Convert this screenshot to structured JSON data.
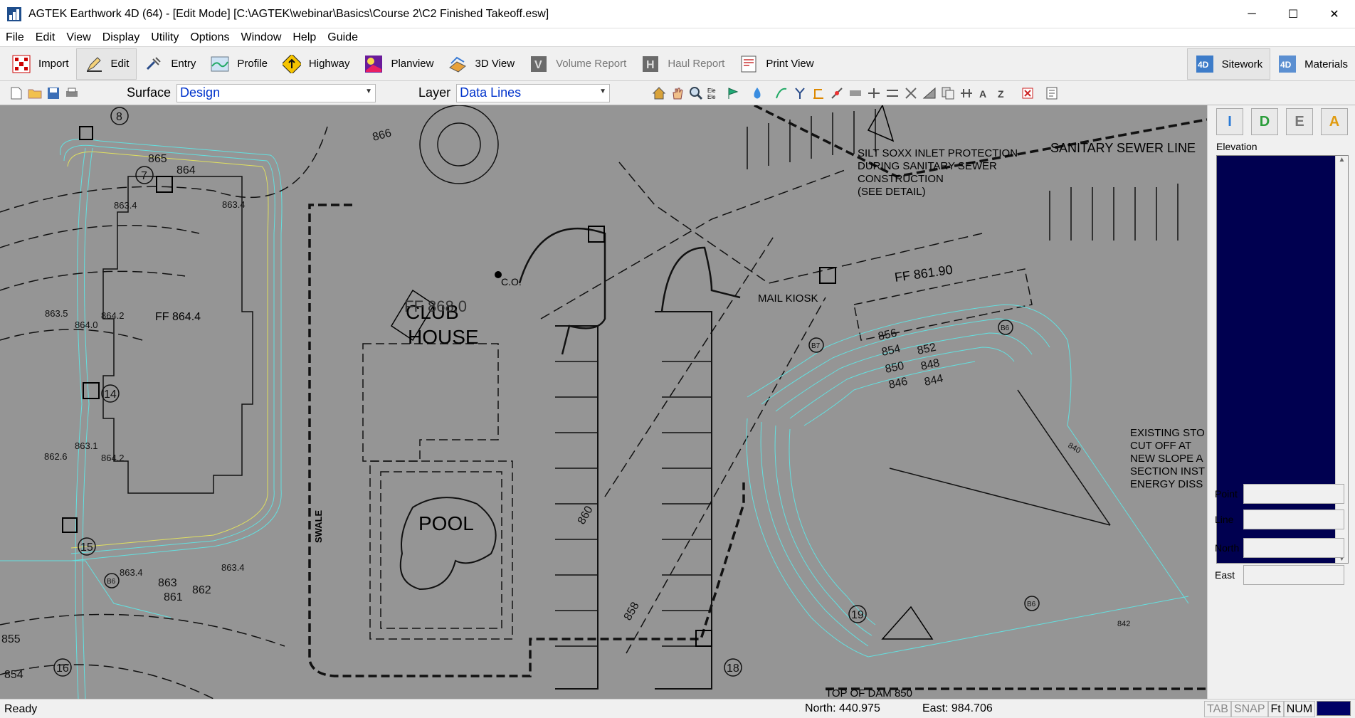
{
  "window": {
    "title": "AGTEK Earthwork 4D (64) - [Edit Mode]  [C:\\AGTEK\\webinar\\Basics\\Course 2\\C2 Finished Takeoff.esw]",
    "controls": [
      "─",
      "☐",
      "✕"
    ]
  },
  "menu": {
    "items": [
      "File",
      "Edit",
      "View",
      "Display",
      "Utility",
      "Options",
      "Window",
      "Help",
      "Guide"
    ]
  },
  "modes": {
    "import": "Import",
    "edit": "Edit",
    "entry": "Entry",
    "profile": "Profile",
    "highway": "Highway",
    "planview": "Planview",
    "view3d": "3D View",
    "volume_report": "Volume Report",
    "haul_report": "Haul Report",
    "print_view": "Print View",
    "sitework": "Sitework",
    "materials": "Materials"
  },
  "toolbar": {
    "surface_label": "Surface",
    "surface_value": "Design",
    "layer_label": "Layer",
    "layer_value": "Data Lines"
  },
  "sidepanel": {
    "buttons": [
      "I",
      "D",
      "E",
      "A"
    ],
    "elevation_label": "Elevation",
    "point_label": "Point",
    "line_label": "Line",
    "north_label": "North",
    "east_label": "East"
  },
  "drawing": {
    "labels": {
      "club": "CLUB",
      "house": "HOUSE",
      "pool": "POOL",
      "ff_club": "FF 868.0",
      "ff_left": "FF 864.4",
      "ff_right": "FF 861.90",
      "sewer": "SANITARY SEWER LINE",
      "silt1": "SILT SOXX INLET PROTECTION",
      "silt2": "DURING SANITARY SEWER",
      "silt3": "CONSTRUCTION",
      "silt4": "(SEE DETAIL)",
      "mail": "MAIL KIOSK",
      "co": "C.O.",
      "swale": "SWALE",
      "existing1": "EXISTING STO",
      "existing2": "CUT OFF AT",
      "existing3": "NEW SLOPE A",
      "existing4": "SECTION INST",
      "existing5": "ENERGY DISS",
      "dam": "TOP OF DAM 850"
    },
    "contours": [
      "866",
      "865",
      "864",
      "863",
      "862",
      "861",
      "860",
      "858",
      "856",
      "854",
      "852",
      "850",
      "848",
      "846",
      "844",
      "842",
      "840",
      "855",
      "854"
    ],
    "spot_elevations": [
      "863.4",
      "863.4",
      "863.5",
      "864.0",
      "864.2",
      "863.1",
      "864.2",
      "862.6",
      "863.4",
      "863.4"
    ],
    "bubbles": [
      "8",
      "7",
      "14",
      "15",
      "16",
      "18",
      "19",
      "B6",
      "B7",
      "B6",
      "B6"
    ]
  },
  "status": {
    "ready": "Ready",
    "north": "North: 440.975",
    "east": "East: 984.706",
    "flags": [
      "TAB",
      "SNAP",
      "Ft",
      "NUM"
    ]
  },
  "colors": {
    "canvas": "#959595",
    "elevation_bg": "#000050",
    "combo_text": "#0033cc"
  }
}
